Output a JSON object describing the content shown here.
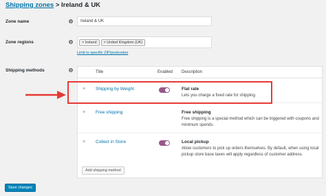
{
  "breadcrumb": {
    "parent": "Shipping zones",
    "separator": " > ",
    "current": "Ireland & UK"
  },
  "fields": {
    "zone_name_label": "Zone name",
    "zone_name_value": "Ireland & UK",
    "zone_regions_label": "Zone regions",
    "regions": [
      "× Ireland",
      "× United Kingdom (UK)"
    ],
    "limit_link": "Limit to specific ZIP/postcodes",
    "shipping_methods_label": "Shipping methods"
  },
  "table": {
    "headers": {
      "title": "Title",
      "enabled": "Enabled",
      "description": "Description"
    },
    "rows": [
      {
        "title": "Shipping by Weight",
        "desc_title": "Flat rate",
        "desc_text": "Lets you charge a fixed rate for shipping."
      },
      {
        "title": "Free shipping",
        "desc_title": "Free shipping",
        "desc_text": "Free shipping is a special method which can be triggered with coupons and minimum spends."
      },
      {
        "title": "Collect in Store",
        "desc_title": "Local pickup",
        "desc_text": "Allow customers to pick up orders themselves. By default, when using local pickup store base taxes will apply regardless of customer address."
      }
    ],
    "add_button": "Add shipping method"
  },
  "save_button": "Save changes",
  "icons": {
    "help": "help-icon",
    "drag": "drag-handle-icon",
    "arrow": "arrow-right-icon"
  },
  "colors": {
    "link": "#0073aa",
    "toggle_on": "#96588a",
    "highlight": "#e53935",
    "save": "#0085ba"
  }
}
